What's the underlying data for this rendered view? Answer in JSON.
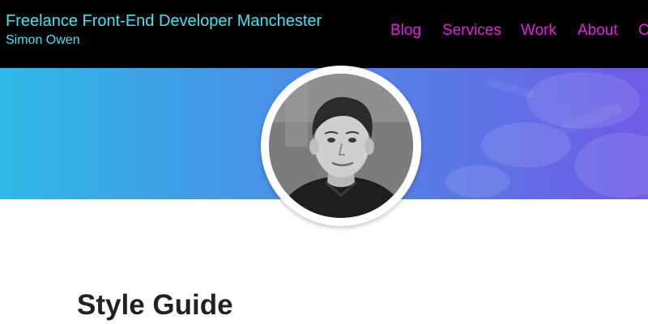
{
  "header": {
    "site_title": "Freelance Front-End Developer Manchester",
    "site_subtitle": "Simon Owen",
    "nav": [
      {
        "label": "Blog"
      },
      {
        "label": "Services"
      },
      {
        "label": "Work"
      },
      {
        "label": "About"
      },
      {
        "label": "Contact"
      }
    ]
  },
  "hero": {
    "avatar_icon": "profile-photo-icon"
  },
  "main": {
    "page_title": "Style Guide"
  },
  "colors": {
    "header_bg": "#000000",
    "title_color": "#3fe4f5",
    "nav_color": "#e51fe3",
    "hero_gradient_start": "#2fb9e6",
    "hero_gradient_end": "#6e5be6",
    "heading_color": "#222222"
  }
}
